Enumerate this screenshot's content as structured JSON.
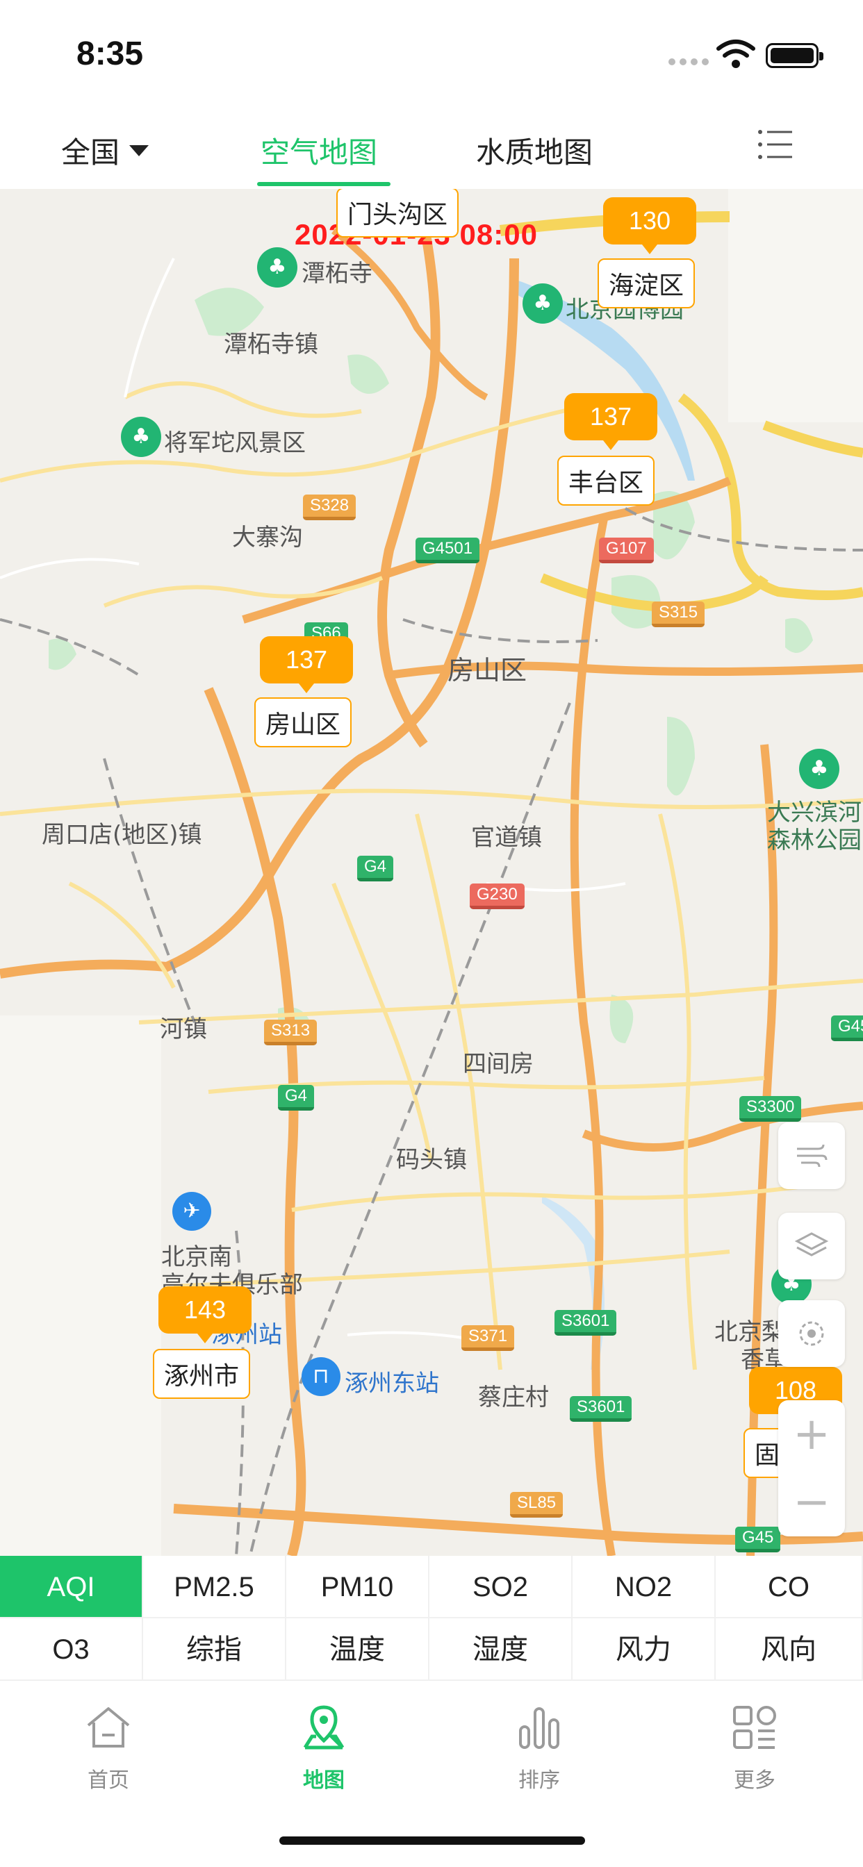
{
  "status_bar": {
    "time": "8:35"
  },
  "header": {
    "region": "全国",
    "tabs": [
      {
        "label": "空气地图",
        "active": true
      },
      {
        "label": "水质地图",
        "active": false
      }
    ],
    "menu_icon": "list-menu-icon"
  },
  "map": {
    "timestamp": "2022-01-23 08:00",
    "stations": [
      {
        "aqi": "130",
        "district": "海淀区"
      },
      {
        "aqi": "137",
        "district": "丰台区"
      },
      {
        "aqi": "137",
        "district": "房山区"
      },
      {
        "aqi": "143",
        "district": "涿州市"
      },
      {
        "aqi": "108",
        "district": "固"
      }
    ],
    "top_label": "门头沟区",
    "places": {
      "tanzhe_temple": "潭柘寺",
      "beijing_park": "北京园博园",
      "tanzhe_town": "潭柘寺镇",
      "jiangjuntuo": "将军坨风景区",
      "dazhaigou": "大寨沟",
      "fangshan": "房山区",
      "zhoukoudian": "周口店(地区)镇",
      "guandao": "官道镇",
      "daxing_forest_1": "大兴滨河",
      "daxing_forest_2": "森林公园",
      "town_left": "河镇",
      "sijianfang": "四间房",
      "matou": "码头镇",
      "beijing_south_1": "北京南",
      "beijing_south_2": "高尔夫俱乐部",
      "zhuozhou_station": "涿州站",
      "zhuozhou_east": "涿州东站",
      "caizhuang": "蔡庄村",
      "beijing_right_1": "北京梨",
      "beijing_right_2": "香草"
    },
    "roads": [
      "S328",
      "G4501",
      "G107",
      "S66",
      "S315",
      "G4",
      "G230",
      "S313",
      "G4",
      "S3300",
      "S371",
      "S3601",
      "S3601",
      "SL85",
      "G45",
      "G45"
    ],
    "tools": [
      "wind-icon",
      "layers-icon",
      "location-icon"
    ],
    "zoom": {
      "in": "+",
      "out": "−"
    }
  },
  "pollutants": {
    "row1": [
      "AQI",
      "PM2.5",
      "PM10",
      "SO2",
      "NO2",
      "CO"
    ],
    "row2": [
      "O3",
      "综指",
      "温度",
      "湿度",
      "风力",
      "风向"
    ],
    "active": "AQI"
  },
  "tabbar": [
    {
      "label": "首页",
      "icon": "home-icon",
      "active": false
    },
    {
      "label": "地图",
      "icon": "map-pin-icon",
      "active": true
    },
    {
      "label": "排序",
      "icon": "bar-chart-icon",
      "active": false
    },
    {
      "label": "更多",
      "icon": "grid-icon",
      "active": false
    }
  ],
  "colors": {
    "accent": "#1ec46a",
    "aqi_badge": "#ffa400",
    "timestamp": "#ff1d1d"
  }
}
